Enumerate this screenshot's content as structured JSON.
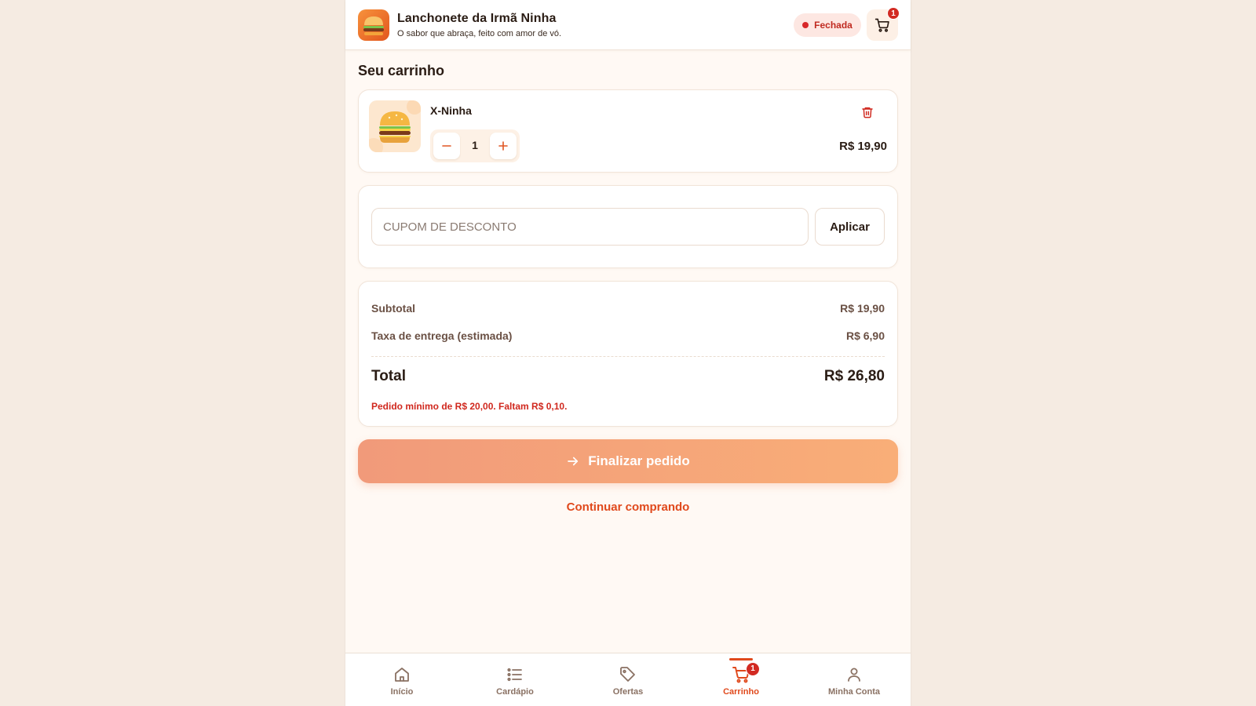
{
  "header": {
    "title": "Lanchonete da Irmã Ninha",
    "subtitle": "O sabor que abraça, feito com amor de vó.",
    "status_label": "Fechada",
    "cart_count": "1"
  },
  "page": {
    "title": "Seu carrinho"
  },
  "cart": {
    "items": [
      {
        "name": "X-Ninha",
        "quantity": "1",
        "price": "R$ 19,90",
        "icon": "burger-icon"
      }
    ]
  },
  "coupon": {
    "placeholder": "CUPOM DE DESCONTO",
    "value": "",
    "apply_label": "Aplicar"
  },
  "summary": {
    "subtotal_label": "Subtotal",
    "subtotal_value": "R$ 19,90",
    "delivery_label": "Taxa de entrega (estimada)",
    "delivery_value": "R$ 6,90",
    "total_label": "Total",
    "total_value": "R$ 26,80",
    "minimum_notice": "Pedido mínimo de R$ 20,00. Faltam R$ 0,10."
  },
  "actions": {
    "finalize_label": "Finalizar pedido",
    "continue_label": "Continuar comprando"
  },
  "nav": {
    "items": [
      {
        "label": "Início",
        "icon": "home-icon"
      },
      {
        "label": "Cardápio",
        "icon": "list-icon"
      },
      {
        "label": "Ofertas",
        "icon": "tag-icon"
      },
      {
        "label": "Carrinho",
        "icon": "cart-icon",
        "active": true,
        "badge": "1"
      },
      {
        "label": "Minha Conta",
        "icon": "user-icon"
      }
    ]
  },
  "colors": {
    "accent": "#e0491c",
    "danger": "#d22a22",
    "background": "#fff9f4",
    "finalize_gradient_start": "#f19a7a",
    "finalize_gradient_end": "#f9ae78"
  }
}
